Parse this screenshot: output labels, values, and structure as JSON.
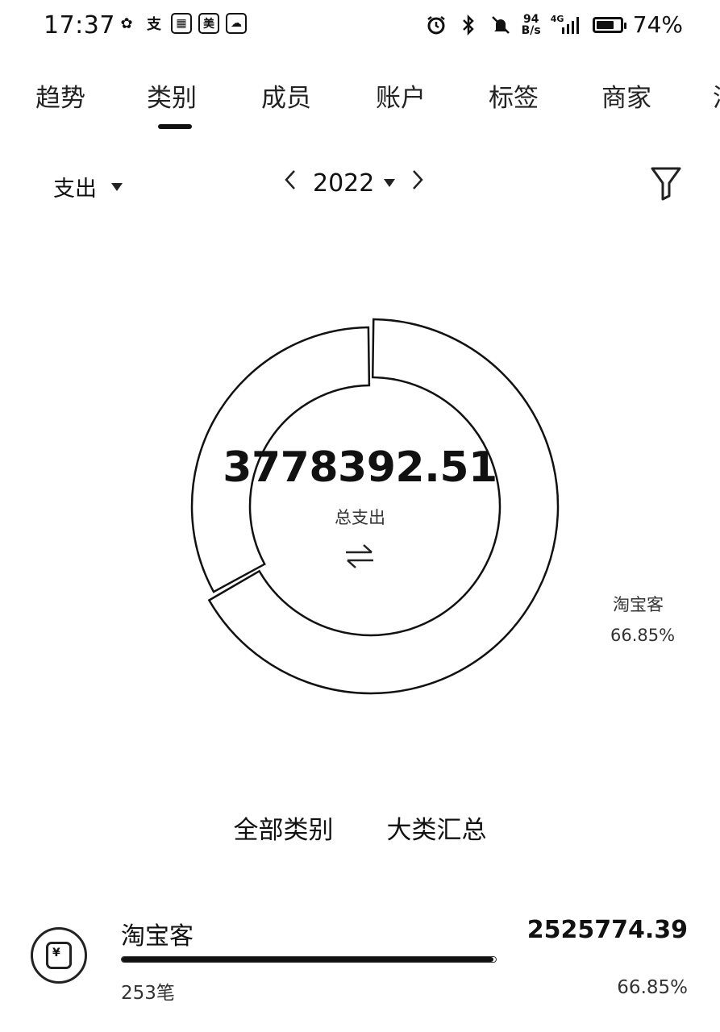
{
  "status_bar": {
    "time": "17:37",
    "app_icons": [
      {
        "name": "wechat-icon",
        "glyph": "✿"
      },
      {
        "name": "alipay-icon",
        "glyph": "支"
      },
      {
        "name": "photo-app-icon",
        "glyph": "▦"
      },
      {
        "name": "meituan-icon",
        "glyph": "美"
      },
      {
        "name": "weather-app-icon",
        "glyph": "☁"
      }
    ],
    "net_speed_value": "94",
    "net_speed_unit": "B/s",
    "network_type": "4G",
    "battery_percent": 74,
    "battery_text": "74%"
  },
  "tabs": [
    "趋势",
    "类别",
    "成员",
    "账户",
    "标签",
    "商家",
    "消"
  ],
  "active_tab": "类别",
  "filter": {
    "type_label": "支出",
    "year": "2022"
  },
  "summary": {
    "total": "3778392.51",
    "total_label": "总支出"
  },
  "chart_data": {
    "type": "pie",
    "variant": "donut",
    "slices": [
      {
        "label": "淘宝客",
        "percent": 66.85,
        "value": 2525774.39
      },
      {
        "label": "",
        "percent": 33.15,
        "value": 1252618.12
      }
    ],
    "highlight_label": "淘宝客",
    "highlight_percent_text": "66.85%"
  },
  "view_tabs": [
    "全部类别",
    "大类汇总"
  ],
  "categories": [
    {
      "name": "淘宝客",
      "amount": "2525774.39",
      "count": "253笔",
      "percent_text": "66.85%",
      "ratio": 0.9936,
      "icon": "yuan-receipt-icon",
      "icon_glyph": "¥"
    }
  ],
  "colors": {
    "text": "#111111",
    "background": "#ffffff"
  }
}
